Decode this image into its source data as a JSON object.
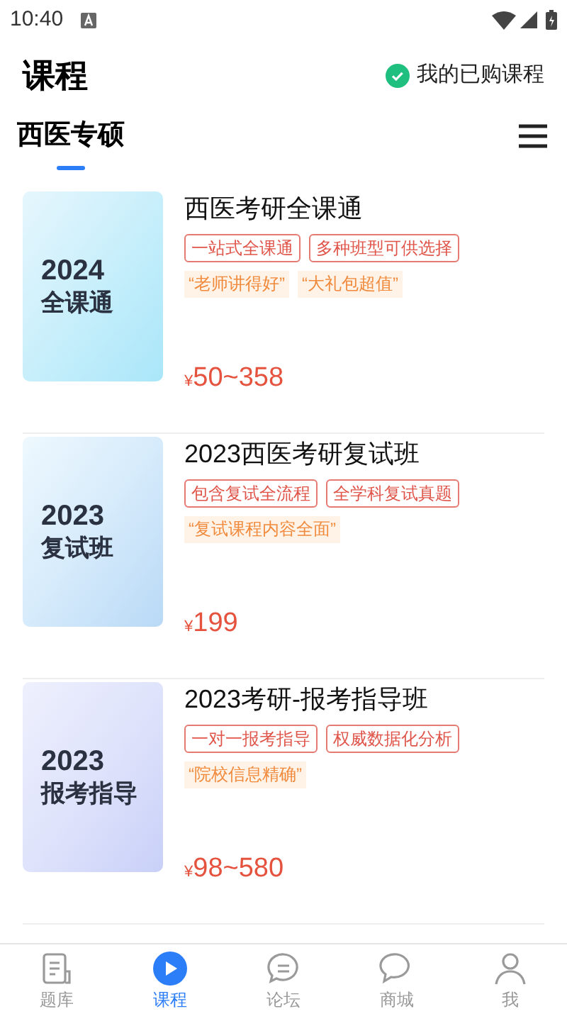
{
  "status_bar": {
    "time": "10:40"
  },
  "header": {
    "title": "课程",
    "purchased_link": "我的已购课程"
  },
  "tabs": [
    {
      "label": "西医专硕",
      "selected": true
    }
  ],
  "courses": [
    {
      "cover_year_text": "2024",
      "cover_title": "全课通",
      "title": "西医考研全课通",
      "tags": [
        "一站式全课通",
        "多种班型可供选择"
      ],
      "quotes": [
        "“老师讲得好”",
        "“大礼包超值”"
      ],
      "currency": "¥",
      "price": "50~358"
    },
    {
      "cover_year_text": "2023",
      "cover_title": "复试班",
      "title": "2023西医考研复试班",
      "tags": [
        "包含复试全流程",
        "全学科复试真题"
      ],
      "quotes": [
        "“复试课程内容全面”"
      ],
      "currency": "¥",
      "price": "199"
    },
    {
      "cover_year_text": "2023",
      "cover_title": "报考指导",
      "title": "2023考研-报考指导班",
      "tags": [
        "一对一报考指导",
        "权威数据化分析"
      ],
      "quotes": [
        "“院校信息精确”"
      ],
      "currency": "¥",
      "price": "98~580"
    }
  ],
  "bottom_nav": [
    {
      "label": "题库",
      "selected": false
    },
    {
      "label": "课程",
      "selected": true
    },
    {
      "label": "论坛",
      "selected": false
    },
    {
      "label": "商城",
      "selected": false
    },
    {
      "label": "我",
      "selected": false
    }
  ]
}
